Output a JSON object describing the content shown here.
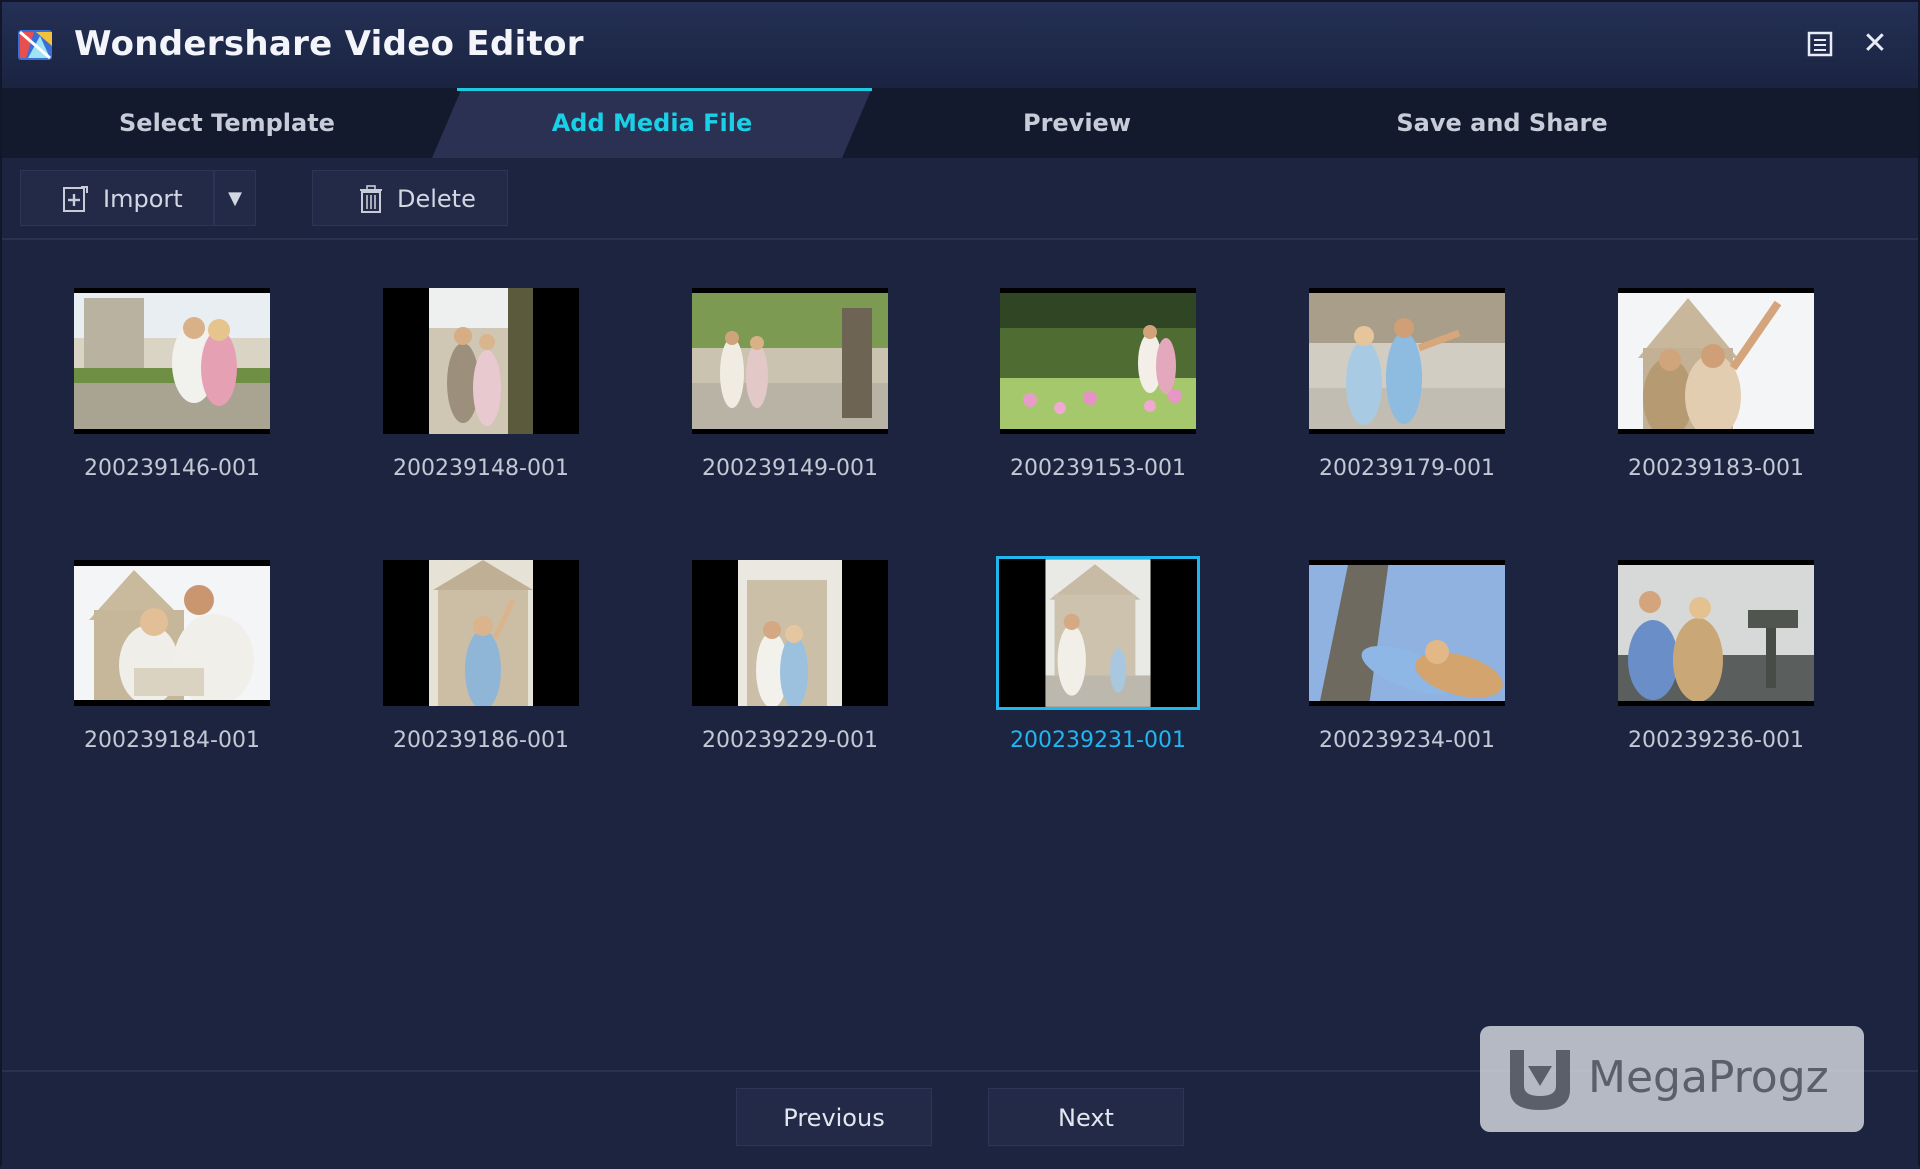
{
  "window": {
    "title": "Wondershare Video Editor",
    "restore_icon": "restore-icon",
    "close_icon": "close-icon"
  },
  "tabs": [
    {
      "label": "Select Template",
      "active": false
    },
    {
      "label": "Add Media File",
      "active": true
    },
    {
      "label": "Preview",
      "active": false
    },
    {
      "label": "Save and Share",
      "active": false
    }
  ],
  "toolbar": {
    "import_label": "Import",
    "import_dropdown": "▼",
    "delete_label": "Delete"
  },
  "media": [
    {
      "name": "200239146-001",
      "selected": false
    },
    {
      "name": "200239148-001",
      "selected": false
    },
    {
      "name": "200239149-001",
      "selected": false
    },
    {
      "name": "200239153-001",
      "selected": false
    },
    {
      "name": "200239179-001",
      "selected": false
    },
    {
      "name": "200239183-001",
      "selected": false
    },
    {
      "name": "200239184-001",
      "selected": false
    },
    {
      "name": "200239186-001",
      "selected": false
    },
    {
      "name": "200239229-001",
      "selected": false
    },
    {
      "name": "200239231-001",
      "selected": true
    },
    {
      "name": "200239234-001",
      "selected": false
    },
    {
      "name": "200239236-001",
      "selected": false
    }
  ],
  "footer": {
    "previous_label": "Previous",
    "next_label": "Next"
  },
  "watermark": {
    "text": "MegaProgz"
  },
  "colors": {
    "accent": "#1ccbe0",
    "selection": "#20b7ee",
    "background": "#1c2440"
  }
}
